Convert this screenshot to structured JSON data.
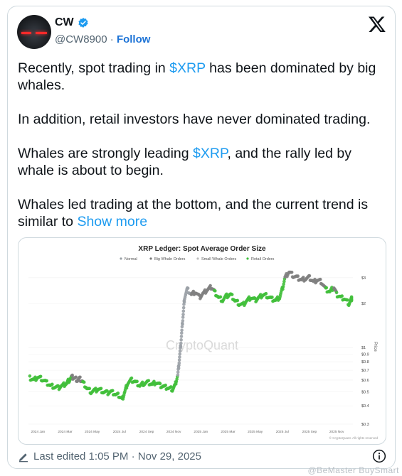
{
  "author": {
    "name": "CW",
    "handle": "@CW8900",
    "separator": "·",
    "follow_label": "Follow",
    "verified_color": "#1d9bf0"
  },
  "tweet": {
    "p1_before": "Recently, spot trading in ",
    "p1_cashtag": "$XRP",
    "p1_after": " has been dominated by big whales.",
    "p2": "In addition, retail investors have never dominated trading.",
    "p3_before": "Whales are strongly leading ",
    "p3_cashtag": "$XRP",
    "p3_after": ", and the rally led by whale is about to begin.",
    "p4": "Whales led trading at the bottom, and the current trend is similar to ",
    "show_more": "Show more"
  },
  "footer": {
    "edited": "Last edited 1:05 PM · Nov 29, 2025"
  },
  "watermark": "@BeMaster BuySmart",
  "chart_data": {
    "type": "scatter",
    "title": "XRP Ledger: Spot Average Order Size",
    "legend": [
      {
        "name": "Normal",
        "color": "#9aa0a6"
      },
      {
        "name": "Big Whale Orders",
        "color": "#7a7a7a"
      },
      {
        "name": "Small Whale Orders",
        "color": "#bdbdbd"
      },
      {
        "name": "Retail Orders",
        "color": "#3fbf3f"
      }
    ],
    "legend_placement": "top-center",
    "watermark": "CryptoQuant",
    "credit": "© CryptoQuant. All rights reserved",
    "ylabel": "Price",
    "yscale": "log",
    "y_ticks": [
      "$3",
      "$2",
      "$1",
      "$0.9",
      "$0.8",
      "$0.7",
      "$0.6",
      "$0.5",
      "$0.4",
      "$0.3"
    ],
    "y_tick_values": [
      3,
      2,
      1,
      0.9,
      0.8,
      0.7,
      0.6,
      0.5,
      0.4,
      0.3
    ],
    "ylim": [
      0.3,
      3.5
    ],
    "x_ticks": [
      "2024 Jan",
      "2024 Mar",
      "2024 May",
      "2024 Jul",
      "2024 Sep",
      "2024 Nov",
      "2025 Jan",
      "2025 Mar",
      "2025 May",
      "2025 Jul",
      "2025 Sep",
      "2025 Nov"
    ],
    "x_tick_months": [
      0,
      2,
      4,
      6,
      8,
      10,
      12,
      14,
      16,
      18,
      20,
      22
    ],
    "xlim_months": [
      -0.7,
      23.2
    ],
    "points": [
      {
        "m": -0.6,
        "p": 0.62,
        "c": "retail"
      },
      {
        "m": -0.3,
        "p": 0.6,
        "c": "retail"
      },
      {
        "m": 0.0,
        "p": 0.63,
        "c": "retail"
      },
      {
        "m": 0.3,
        "p": 0.61,
        "c": "retail"
      },
      {
        "m": 0.6,
        "p": 0.58,
        "c": "retail"
      },
      {
        "m": 0.9,
        "p": 0.55,
        "c": "retail"
      },
      {
        "m": 1.2,
        "p": 0.54,
        "c": "retail"
      },
      {
        "m": 1.5,
        "p": 0.53,
        "c": "retail"
      },
      {
        "m": 1.8,
        "p": 0.55,
        "c": "retail"
      },
      {
        "m": 2.1,
        "p": 0.57,
        "c": "retail"
      },
      {
        "m": 2.3,
        "p": 0.6,
        "c": "retail"
      },
      {
        "m": 2.5,
        "p": 0.63,
        "c": "big"
      },
      {
        "m": 2.7,
        "p": 0.62,
        "c": "big"
      },
      {
        "m": 2.9,
        "p": 0.6,
        "c": "big"
      },
      {
        "m": 3.1,
        "p": 0.61,
        "c": "big"
      },
      {
        "m": 3.3,
        "p": 0.58,
        "c": "retail"
      },
      {
        "m": 3.6,
        "p": 0.53,
        "c": "retail"
      },
      {
        "m": 3.9,
        "p": 0.5,
        "c": "retail"
      },
      {
        "m": 4.2,
        "p": 0.51,
        "c": "retail"
      },
      {
        "m": 4.5,
        "p": 0.52,
        "c": "retail"
      },
      {
        "m": 4.8,
        "p": 0.5,
        "c": "retail"
      },
      {
        "m": 5.1,
        "p": 0.49,
        "c": "retail"
      },
      {
        "m": 5.4,
        "p": 0.5,
        "c": "retail"
      },
      {
        "m": 5.7,
        "p": 0.48,
        "c": "retail"
      },
      {
        "m": 6.0,
        "p": 0.47,
        "c": "retail"
      },
      {
        "m": 6.2,
        "p": 0.44,
        "c": "retail"
      },
      {
        "m": 6.4,
        "p": 0.5,
        "c": "retail"
      },
      {
        "m": 6.6,
        "p": 0.57,
        "c": "retail"
      },
      {
        "m": 6.9,
        "p": 0.6,
        "c": "retail"
      },
      {
        "m": 7.2,
        "p": 0.58,
        "c": "retail"
      },
      {
        "m": 7.5,
        "p": 0.55,
        "c": "retail"
      },
      {
        "m": 7.8,
        "p": 0.57,
        "c": "retail"
      },
      {
        "m": 8.1,
        "p": 0.58,
        "c": "retail"
      },
      {
        "m": 8.4,
        "p": 0.56,
        "c": "retail"
      },
      {
        "m": 8.7,
        "p": 0.58,
        "c": "retail"
      },
      {
        "m": 9.0,
        "p": 0.55,
        "c": "retail"
      },
      {
        "m": 9.3,
        "p": 0.54,
        "c": "retail"
      },
      {
        "m": 9.6,
        "p": 0.53,
        "c": "retail"
      },
      {
        "m": 9.9,
        "p": 0.52,
        "c": "retail"
      },
      {
        "m": 10.1,
        "p": 0.55,
        "c": "retail"
      },
      {
        "m": 10.3,
        "p": 0.65,
        "c": "normal"
      },
      {
        "m": 10.4,
        "p": 0.8,
        "c": "normal"
      },
      {
        "m": 10.5,
        "p": 1.0,
        "c": "normal"
      },
      {
        "m": 10.6,
        "p": 1.3,
        "c": "normal"
      },
      {
        "m": 10.7,
        "p": 1.7,
        "c": "normal"
      },
      {
        "m": 10.8,
        "p": 2.2,
        "c": "normal"
      },
      {
        "m": 11.0,
        "p": 2.5,
        "c": "normal"
      },
      {
        "m": 11.3,
        "p": 2.3,
        "c": "big"
      },
      {
        "m": 11.6,
        "p": 2.4,
        "c": "big"
      },
      {
        "m": 11.9,
        "p": 2.2,
        "c": "big"
      },
      {
        "m": 12.2,
        "p": 2.35,
        "c": "big"
      },
      {
        "m": 12.5,
        "p": 2.5,
        "c": "big"
      },
      {
        "m": 12.8,
        "p": 2.6,
        "c": "big"
      },
      {
        "m": 13.0,
        "p": 2.4,
        "c": "retail"
      },
      {
        "m": 13.3,
        "p": 2.2,
        "c": "retail"
      },
      {
        "m": 13.6,
        "p": 2.1,
        "c": "retail"
      },
      {
        "m": 13.9,
        "p": 2.25,
        "c": "retail"
      },
      {
        "m": 14.2,
        "p": 2.3,
        "c": "retail"
      },
      {
        "m": 14.5,
        "p": 2.1,
        "c": "retail"
      },
      {
        "m": 14.8,
        "p": 2.0,
        "c": "retail"
      },
      {
        "m": 15.1,
        "p": 1.95,
        "c": "retail"
      },
      {
        "m": 15.4,
        "p": 2.1,
        "c": "retail"
      },
      {
        "m": 15.7,
        "p": 2.2,
        "c": "retail"
      },
      {
        "m": 16.0,
        "p": 2.1,
        "c": "retail"
      },
      {
        "m": 16.3,
        "p": 2.2,
        "c": "retail"
      },
      {
        "m": 16.6,
        "p": 2.3,
        "c": "retail"
      },
      {
        "m": 16.9,
        "p": 2.25,
        "c": "retail"
      },
      {
        "m": 17.2,
        "p": 2.15,
        "c": "retail"
      },
      {
        "m": 17.5,
        "p": 2.1,
        "c": "retail"
      },
      {
        "m": 17.8,
        "p": 2.2,
        "c": "retail"
      },
      {
        "m": 18.0,
        "p": 2.5,
        "c": "retail"
      },
      {
        "m": 18.2,
        "p": 3.0,
        "c": "big"
      },
      {
        "m": 18.5,
        "p": 3.3,
        "c": "big"
      },
      {
        "m": 18.8,
        "p": 3.1,
        "c": "big"
      },
      {
        "m": 19.1,
        "p": 3.0,
        "c": "big"
      },
      {
        "m": 19.4,
        "p": 2.9,
        "c": "big"
      },
      {
        "m": 19.7,
        "p": 2.95,
        "c": "big"
      },
      {
        "m": 20.0,
        "p": 3.0,
        "c": "big"
      },
      {
        "m": 20.3,
        "p": 2.8,
        "c": "big"
      },
      {
        "m": 20.6,
        "p": 2.9,
        "c": "big"
      },
      {
        "m": 20.9,
        "p": 2.8,
        "c": "big"
      },
      {
        "m": 21.2,
        "p": 2.5,
        "c": "retail"
      },
      {
        "m": 21.5,
        "p": 2.4,
        "c": "retail"
      },
      {
        "m": 21.8,
        "p": 2.6,
        "c": "big"
      },
      {
        "m": 22.0,
        "p": 2.3,
        "c": "retail"
      },
      {
        "m": 22.3,
        "p": 2.2,
        "c": "retail"
      },
      {
        "m": 22.6,
        "p": 2.15,
        "c": "retail"
      },
      {
        "m": 22.9,
        "p": 2.0,
        "c": "retail"
      },
      {
        "m": 23.1,
        "p": 2.15,
        "c": "retail"
      }
    ]
  }
}
